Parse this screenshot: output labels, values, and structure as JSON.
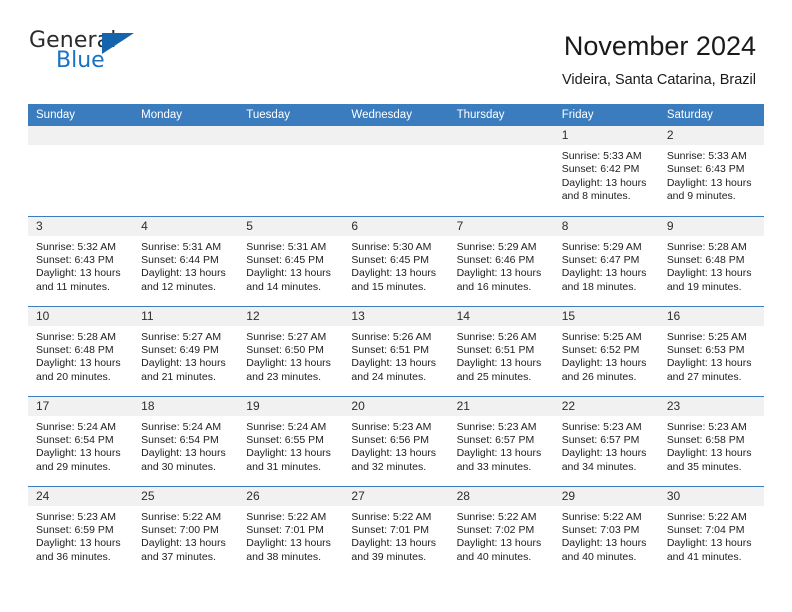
{
  "logo": {
    "word_top": "General",
    "word_bottom": "Blue",
    "triangle_icon": "triangle-icon",
    "colors": {
      "text": "#2b2b2b",
      "blue": "#1a72c4",
      "triangle": "#1565ad"
    }
  },
  "header": {
    "title": "November 2024",
    "subtitle": "Videira, Santa Catarina, Brazil"
  },
  "theme": {
    "header_blue": "#3a7cbe",
    "daynum_bg": "#f1f1f1",
    "text": "#1d1d1d"
  },
  "calendar": {
    "weekdays": [
      "Sunday",
      "Monday",
      "Tuesday",
      "Wednesday",
      "Thursday",
      "Friday",
      "Saturday"
    ],
    "weeks": [
      [
        {
          "day": "",
          "empty": true
        },
        {
          "day": "",
          "empty": true
        },
        {
          "day": "",
          "empty": true
        },
        {
          "day": "",
          "empty": true
        },
        {
          "day": "",
          "empty": true
        },
        {
          "day": "1",
          "sunrise": "Sunrise: 5:33 AM",
          "sunset": "Sunset: 6:42 PM",
          "daylight": "Daylight: 13 hours and 8 minutes."
        },
        {
          "day": "2",
          "sunrise": "Sunrise: 5:33 AM",
          "sunset": "Sunset: 6:43 PM",
          "daylight": "Daylight: 13 hours and 9 minutes."
        }
      ],
      [
        {
          "day": "3",
          "sunrise": "Sunrise: 5:32 AM",
          "sunset": "Sunset: 6:43 PM",
          "daylight": "Daylight: 13 hours and 11 minutes."
        },
        {
          "day": "4",
          "sunrise": "Sunrise: 5:31 AM",
          "sunset": "Sunset: 6:44 PM",
          "daylight": "Daylight: 13 hours and 12 minutes."
        },
        {
          "day": "5",
          "sunrise": "Sunrise: 5:31 AM",
          "sunset": "Sunset: 6:45 PM",
          "daylight": "Daylight: 13 hours and 14 minutes."
        },
        {
          "day": "6",
          "sunrise": "Sunrise: 5:30 AM",
          "sunset": "Sunset: 6:45 PM",
          "daylight": "Daylight: 13 hours and 15 minutes."
        },
        {
          "day": "7",
          "sunrise": "Sunrise: 5:29 AM",
          "sunset": "Sunset: 6:46 PM",
          "daylight": "Daylight: 13 hours and 16 minutes."
        },
        {
          "day": "8",
          "sunrise": "Sunrise: 5:29 AM",
          "sunset": "Sunset: 6:47 PM",
          "daylight": "Daylight: 13 hours and 18 minutes."
        },
        {
          "day": "9",
          "sunrise": "Sunrise: 5:28 AM",
          "sunset": "Sunset: 6:48 PM",
          "daylight": "Daylight: 13 hours and 19 minutes."
        }
      ],
      [
        {
          "day": "10",
          "sunrise": "Sunrise: 5:28 AM",
          "sunset": "Sunset: 6:48 PM",
          "daylight": "Daylight: 13 hours and 20 minutes."
        },
        {
          "day": "11",
          "sunrise": "Sunrise: 5:27 AM",
          "sunset": "Sunset: 6:49 PM",
          "daylight": "Daylight: 13 hours and 21 minutes."
        },
        {
          "day": "12",
          "sunrise": "Sunrise: 5:27 AM",
          "sunset": "Sunset: 6:50 PM",
          "daylight": "Daylight: 13 hours and 23 minutes."
        },
        {
          "day": "13",
          "sunrise": "Sunrise: 5:26 AM",
          "sunset": "Sunset: 6:51 PM",
          "daylight": "Daylight: 13 hours and 24 minutes."
        },
        {
          "day": "14",
          "sunrise": "Sunrise: 5:26 AM",
          "sunset": "Sunset: 6:51 PM",
          "daylight": "Daylight: 13 hours and 25 minutes."
        },
        {
          "day": "15",
          "sunrise": "Sunrise: 5:25 AM",
          "sunset": "Sunset: 6:52 PM",
          "daylight": "Daylight: 13 hours and 26 minutes."
        },
        {
          "day": "16",
          "sunrise": "Sunrise: 5:25 AM",
          "sunset": "Sunset: 6:53 PM",
          "daylight": "Daylight: 13 hours and 27 minutes."
        }
      ],
      [
        {
          "day": "17",
          "sunrise": "Sunrise: 5:24 AM",
          "sunset": "Sunset: 6:54 PM",
          "daylight": "Daylight: 13 hours and 29 minutes."
        },
        {
          "day": "18",
          "sunrise": "Sunrise: 5:24 AM",
          "sunset": "Sunset: 6:54 PM",
          "daylight": "Daylight: 13 hours and 30 minutes."
        },
        {
          "day": "19",
          "sunrise": "Sunrise: 5:24 AM",
          "sunset": "Sunset: 6:55 PM",
          "daylight": "Daylight: 13 hours and 31 minutes."
        },
        {
          "day": "20",
          "sunrise": "Sunrise: 5:23 AM",
          "sunset": "Sunset: 6:56 PM",
          "daylight": "Daylight: 13 hours and 32 minutes."
        },
        {
          "day": "21",
          "sunrise": "Sunrise: 5:23 AM",
          "sunset": "Sunset: 6:57 PM",
          "daylight": "Daylight: 13 hours and 33 minutes."
        },
        {
          "day": "22",
          "sunrise": "Sunrise: 5:23 AM",
          "sunset": "Sunset: 6:57 PM",
          "daylight": "Daylight: 13 hours and 34 minutes."
        },
        {
          "day": "23",
          "sunrise": "Sunrise: 5:23 AM",
          "sunset": "Sunset: 6:58 PM",
          "daylight": "Daylight: 13 hours and 35 minutes."
        }
      ],
      [
        {
          "day": "24",
          "sunrise": "Sunrise: 5:23 AM",
          "sunset": "Sunset: 6:59 PM",
          "daylight": "Daylight: 13 hours and 36 minutes."
        },
        {
          "day": "25",
          "sunrise": "Sunrise: 5:22 AM",
          "sunset": "Sunset: 7:00 PM",
          "daylight": "Daylight: 13 hours and 37 minutes."
        },
        {
          "day": "26",
          "sunrise": "Sunrise: 5:22 AM",
          "sunset": "Sunset: 7:01 PM",
          "daylight": "Daylight: 13 hours and 38 minutes."
        },
        {
          "day": "27",
          "sunrise": "Sunrise: 5:22 AM",
          "sunset": "Sunset: 7:01 PM",
          "daylight": "Daylight: 13 hours and 39 minutes."
        },
        {
          "day": "28",
          "sunrise": "Sunrise: 5:22 AM",
          "sunset": "Sunset: 7:02 PM",
          "daylight": "Daylight: 13 hours and 40 minutes."
        },
        {
          "day": "29",
          "sunrise": "Sunrise: 5:22 AM",
          "sunset": "Sunset: 7:03 PM",
          "daylight": "Daylight: 13 hours and 40 minutes."
        },
        {
          "day": "30",
          "sunrise": "Sunrise: 5:22 AM",
          "sunset": "Sunset: 7:04 PM",
          "daylight": "Daylight: 13 hours and 41 minutes."
        }
      ]
    ]
  }
}
